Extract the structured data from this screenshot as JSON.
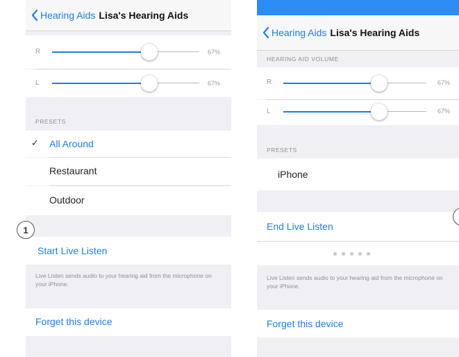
{
  "left": {
    "back_label": "Hearing Aids",
    "title": "Lisa's Hearing Aids",
    "slider_r": {
      "label": "R",
      "value_text": "67%",
      "value": 0.67
    },
    "slider_l": {
      "label": "L",
      "value_text": "67%",
      "value": 0.67
    },
    "presets_header": "PRESETS",
    "checkmark": "✓",
    "presets": [
      "All Around",
      "Restaurant",
      "Outdoor"
    ],
    "selected_preset": "All Around",
    "live_listen_label": "Start Live Listen",
    "live_listen_footer": "Live Listen sends audio to your hearing aid from the microphone on your iPhone.",
    "forget_label": "Forget this device"
  },
  "right": {
    "back_label": "Hearing Aids",
    "title": "Lisa's Hearing Aids",
    "volume_header": "HEARING AID VOLUME",
    "slider_r": {
      "label": "R",
      "value_text": "67%",
      "value": 0.67
    },
    "slider_l": {
      "label": "L",
      "value_text": "67%",
      "value": 0.67
    },
    "presets_header": "PRESETS",
    "presets": [
      "iPhone"
    ],
    "live_listen_label": "End Live Listen",
    "live_listen_footer": "Live Listen sends audio to your hearing aid from the microphone on your iPhone.",
    "forget_label": "Forget this device"
  },
  "callout_1": "1",
  "colors": {
    "accent": "#1a7df5",
    "status_bar": "#2a8cf4",
    "group_bg": "#efeff4"
  }
}
